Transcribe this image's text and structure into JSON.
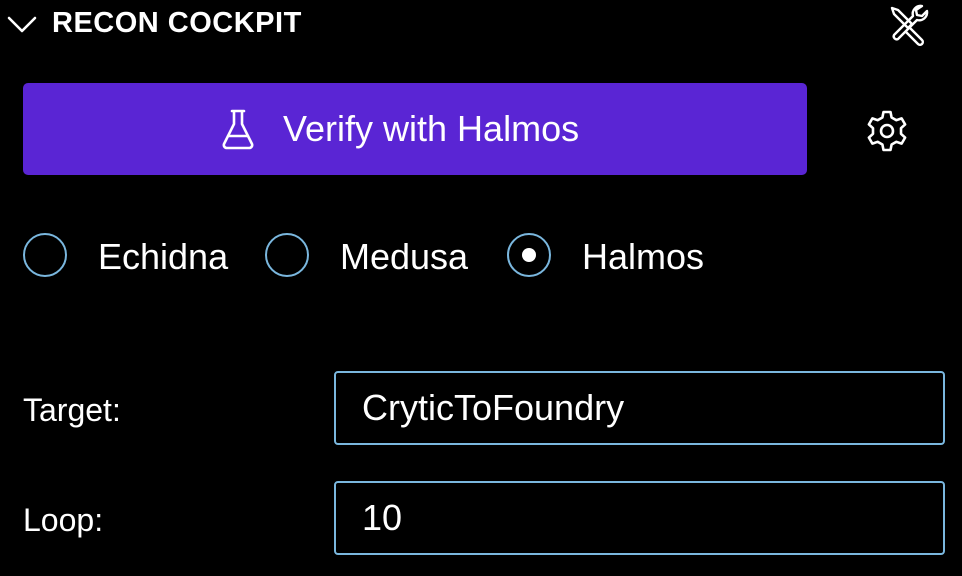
{
  "header": {
    "title": "RECON COCKPIT",
    "collapse_icon": "chevron-down-icon",
    "tools_icon": "tools-icon"
  },
  "primary_action": {
    "label": "Verify with Halmos",
    "icon": "flask-icon",
    "background": "#5a25d4"
  },
  "settings_icon": "gear-icon",
  "tools": {
    "options": [
      {
        "label": "Echidna",
        "selected": false
      },
      {
        "label": "Medusa",
        "selected": false
      },
      {
        "label": "Halmos",
        "selected": true
      }
    ]
  },
  "form": {
    "target_label": "Target:",
    "target_value": "CryticToFoundry",
    "loop_label": "Loop:",
    "loop_value": "10"
  },
  "colors": {
    "accent": "#5a25d4",
    "border": "#7ab7de",
    "background": "#000000"
  }
}
